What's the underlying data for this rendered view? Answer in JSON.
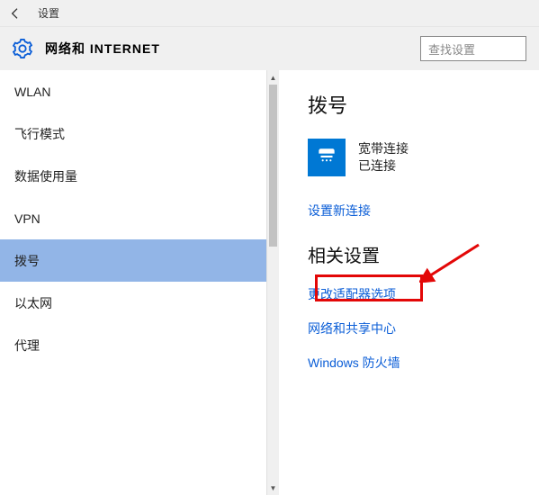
{
  "topbar": {
    "title": "设置"
  },
  "header": {
    "title": "网络和 INTERNET",
    "search_placeholder": "查找设置"
  },
  "sidebar": {
    "items": [
      {
        "label": "WLAN",
        "selected": false
      },
      {
        "label": "飞行模式",
        "selected": false
      },
      {
        "label": "数据使用量",
        "selected": false
      },
      {
        "label": "VPN",
        "selected": false
      },
      {
        "label": "拨号",
        "selected": true
      },
      {
        "label": "以太网",
        "selected": false
      },
      {
        "label": "代理",
        "selected": false
      }
    ]
  },
  "main": {
    "section1_title": "拨号",
    "connection": {
      "name": "宽带连接",
      "status": "已连接",
      "icon": "phone-icon"
    },
    "new_connection_link": "设置新连接",
    "section2_title": "相关设置",
    "links": {
      "adapter_options": "更改适配器选项",
      "sharing_center": "网络和共享中心",
      "firewall": "Windows 防火墙"
    }
  }
}
